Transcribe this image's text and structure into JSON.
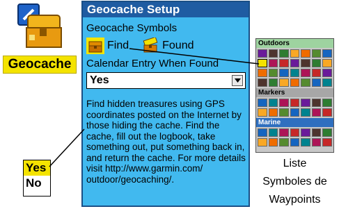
{
  "app": {
    "icon": "geocache-treasure-chest-icon",
    "label": "Geocache"
  },
  "window": {
    "title": "Geocache Setup",
    "symbols_label": "Geocache Symbols",
    "find_label": "Find",
    "found_label": "Found",
    "calendar_label": "Calendar Entry When Found",
    "calendar_value": "Yes",
    "description": "Find hidden treasures using GPS coordinates posted on the Internet by those hiding the cache. Find the cache, fill out the logbook, take something out, put something back in, and return the cache. For more details visit http://www.garmin.com/ outdoor/geocaching/."
  },
  "callout": {
    "options": [
      "Yes",
      "No"
    ],
    "selected": "Yes"
  },
  "symbol_panel": {
    "sections": [
      "Outdoors",
      "Markers",
      "Marine"
    ],
    "caption_line1": "Liste",
    "caption_line2": "Symboles de",
    "caption_line3": "Waypoints"
  },
  "colors": {
    "window_bg": "#41b9ef",
    "titlebar": "#1f5ca2",
    "highlight": "#f4e300"
  }
}
